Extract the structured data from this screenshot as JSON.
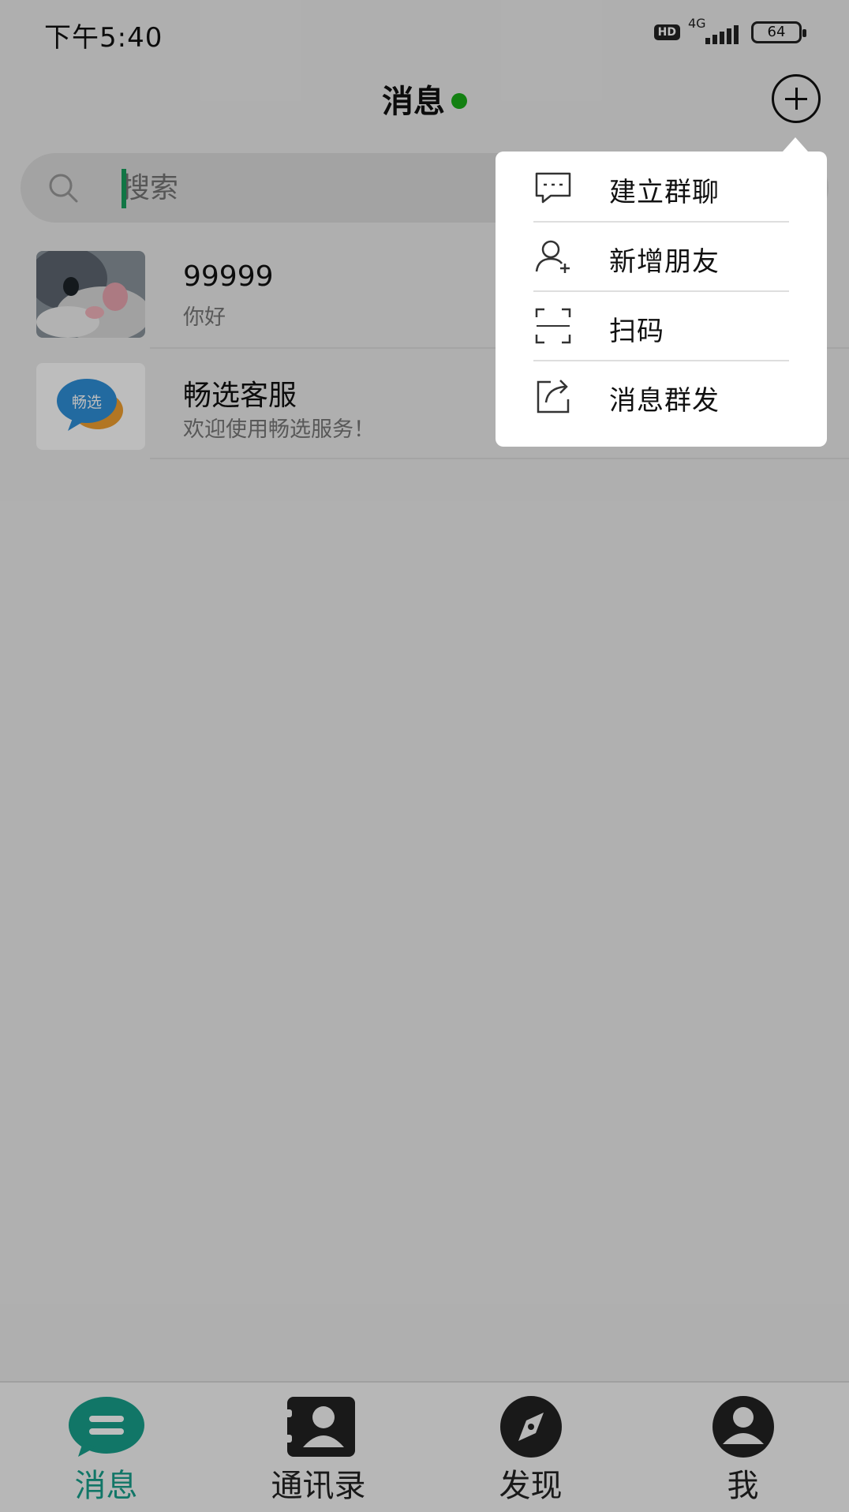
{
  "status_bar": {
    "time": "下午5:40",
    "hd": "HD",
    "network": "4G",
    "battery": "64"
  },
  "header": {
    "title": "消息",
    "online_color": "#1aad19"
  },
  "search": {
    "placeholder": "搜索"
  },
  "chats": [
    {
      "name": "99999",
      "message": "你好",
      "avatar": "cat-photo"
    },
    {
      "name": "畅选客服",
      "message": "欢迎使用畅选服务！",
      "avatar": "changxuan-logo",
      "avatar_text": "畅选"
    }
  ],
  "popup_menu": {
    "items": [
      {
        "label": "建立群聊",
        "icon": "chat-bubble-icon"
      },
      {
        "label": "新增朋友",
        "icon": "add-friend-icon"
      },
      {
        "label": "扫码",
        "icon": "scan-icon"
      },
      {
        "label": "消息群发",
        "icon": "share-icon"
      }
    ]
  },
  "tab_bar": {
    "active_color": "#17a08b",
    "tabs": [
      {
        "label": "消息",
        "icon": "message-icon",
        "active": true
      },
      {
        "label": "通讯录",
        "icon": "contacts-icon",
        "active": false
      },
      {
        "label": "发现",
        "icon": "compass-icon",
        "active": false
      },
      {
        "label": "我",
        "icon": "profile-icon",
        "active": false
      }
    ]
  }
}
